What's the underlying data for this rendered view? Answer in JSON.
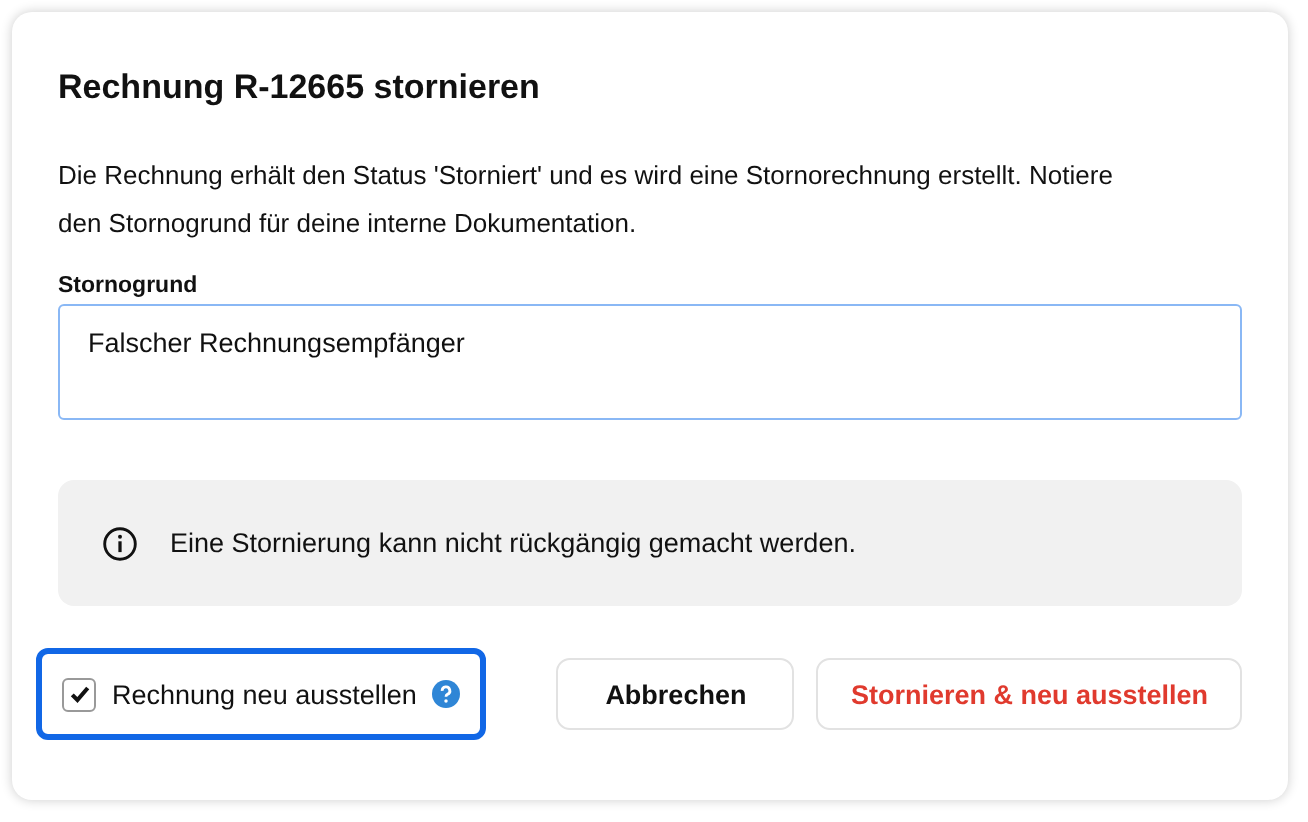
{
  "dialog": {
    "title": "Rechnung R-12665 stornieren",
    "description": "Die Rechnung erhält den Status 'Storniert' und es wird eine Stornorechnung erstellt. Notiere den Stornogrund für deine interne Dokumentation.",
    "reason": {
      "label": "Stornogrund",
      "value": "Falscher Rechnungsempfänger",
      "focused": true
    },
    "notice": "Eine Stornierung kann nicht rückgängig gemacht werden.",
    "reissue": {
      "label": "Rechnung neu ausstellen",
      "checked": true,
      "focused": true
    },
    "buttons": [
      {
        "label": "Abbrechen",
        "kind": "secondary"
      },
      {
        "label": "Stornieren & neu ausstellen",
        "kind": "danger"
      }
    ]
  }
}
